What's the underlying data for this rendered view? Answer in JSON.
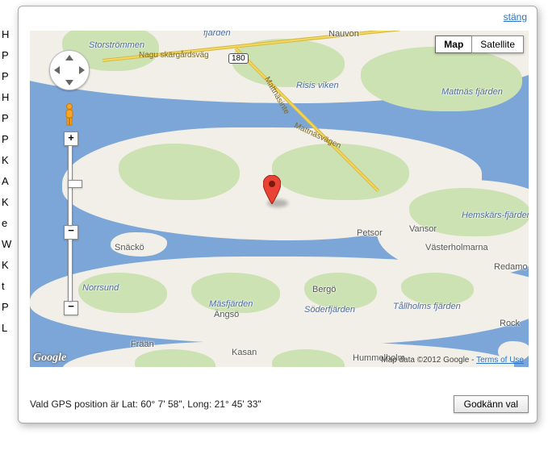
{
  "bg_items": [
    "H",
    "P",
    "P",
    "H",
    "P",
    "P",
    "K",
    "A",
    "K",
    "e",
    "W",
    "K",
    "t",
    "P",
    "L"
  ],
  "close_label": "stäng",
  "maptype": {
    "map": "Map",
    "satellite": "Satellite",
    "active": "map"
  },
  "zoom": {
    "in": "+",
    "out": "−"
  },
  "road": {
    "shield": "180",
    "name1": "Nagu skärgårdsväg",
    "name2": "Mattnäsvägen",
    "name3": "Mattnäsinte"
  },
  "places": {
    "storstrommen": "Storströmmen",
    "fjarden_top": "fjärden",
    "naudvon": "Nauvon",
    "risis": "Risis viken",
    "mattnas": "Mattnäs fjärden",
    "petsor": "Petsor",
    "vansor": "Vansor",
    "hemskars": "Hemskärs-fjärden",
    "snacko": "Snäckö",
    "vasterholmarna": "Västerholmarna",
    "redamo": "Redamo",
    "norrsund": "Norrsund",
    "bergo": "Bergö",
    "angso": "Ängsö",
    "masfjarden": "Mäsfjärden",
    "soderfjarden": "Söderfjärden",
    "tallholms": "Tållholms fjärden",
    "rock": "Rock",
    "fraan": "Frään",
    "kasan": "Kasan",
    "hummelholm": "Hummelholm"
  },
  "attribution": {
    "google": "Google",
    "text": "Map data ©2012 Google",
    "terms": "Terms of Use"
  },
  "footer": {
    "status_prefix": "Vald GPS position är Lat: ",
    "lat": "60° 7' 58\"",
    "mid": ", Long: ",
    "lng": "21° 45' 33\"",
    "accept": "Godkänn val"
  }
}
